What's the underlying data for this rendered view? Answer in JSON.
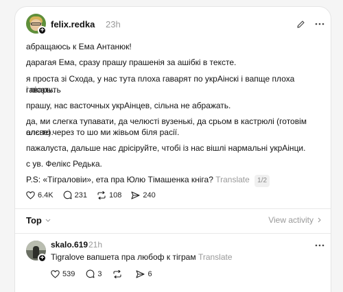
{
  "post": {
    "username": "felix.redka",
    "time": "23h",
    "paragraphs": [
      "абращаюсь к Ема Антанюк!",
      "дарагая Ема, сразу прашу прашенія за ашібкі в тексте.",
      "я проста зі Схода, у нас тута плоха гаварят по укрАінскі і вапще плоха гаварыть",
      "і пісать.",
      "прашу, нас васточных укрАінцев, сільна не абражать.",
      "да, ми слегка тупавати, да челюсті вузенькі, да срьом в кастрюлі (готовім олєве).",
      "алє то через то шо ми жівьом біля расії.",
      "пажалуста, дальше нас дрісіруйте, чтобі із нас вішлі нармальні укрАінци.",
      "с ув. Фелікс Редька."
    ],
    "last_line": "P.S: «Тіграловіи», ета пра Юлю Тімашенка кніга?",
    "translate_label": "Translate",
    "pager": "1/2",
    "likes": "6.4K",
    "comments": "231",
    "reposts": "108",
    "shares": "240"
  },
  "sort": {
    "label": "Top",
    "view_activity": "View activity"
  },
  "reply": {
    "username": "skalo.619",
    "time": "21h",
    "text": "Tigralove вапшета пра любоф к тіграм",
    "translate_label": "Translate",
    "likes": "539",
    "comments": "3",
    "shares": "6"
  },
  "icons": [
    "edit-icon",
    "more-icon",
    "heart-icon",
    "comment-icon",
    "repost-icon",
    "share-icon",
    "chevron-down-icon",
    "chevron-right-icon"
  ]
}
